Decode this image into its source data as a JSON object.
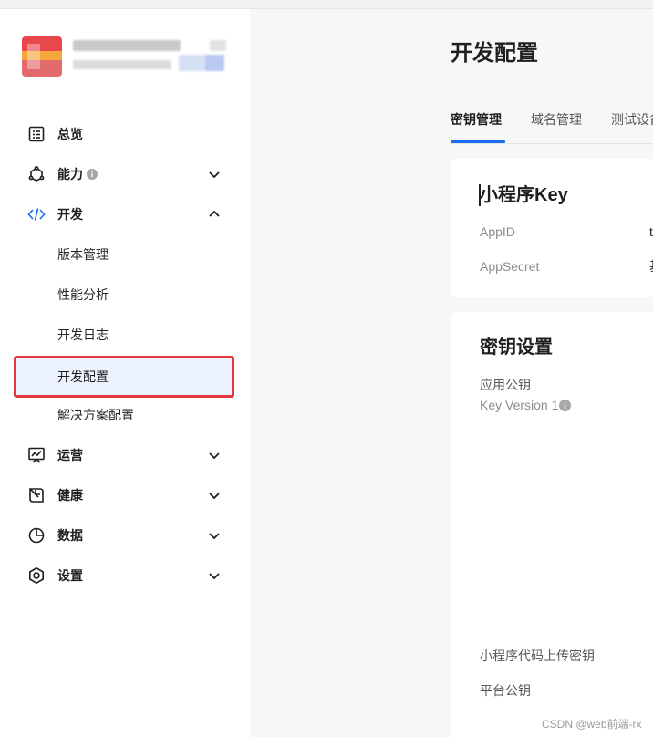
{
  "sidebar": {
    "nav": [
      {
        "id": "overview",
        "label": "总览",
        "icon": "dashboard-icon"
      },
      {
        "id": "capability",
        "label": "能力",
        "icon": "capability-icon",
        "has_info": true,
        "expanded": false
      },
      {
        "id": "develop",
        "label": "开发",
        "icon": "code-icon",
        "expanded": true
      },
      {
        "id": "operation",
        "label": "运营",
        "icon": "trend-chart-icon",
        "expanded": false
      },
      {
        "id": "health",
        "label": "健康",
        "icon": "leaf-icon",
        "expanded": false
      },
      {
        "id": "data",
        "label": "数据",
        "icon": "pie-chart-icon",
        "expanded": false
      },
      {
        "id": "settings",
        "label": "设置",
        "icon": "gear-icon",
        "expanded": false
      }
    ],
    "develop_children": [
      {
        "label": "版本管理"
      },
      {
        "label": "性能分析"
      },
      {
        "label": "开发日志"
      },
      {
        "label": "开发配置",
        "active": true
      },
      {
        "label": "解决方案配置"
      }
    ]
  },
  "main": {
    "title": "开发配置",
    "tabs": [
      {
        "label": "密钥管理",
        "active": true
      },
      {
        "label": "域名管理"
      },
      {
        "label": "测试设备"
      }
    ],
    "key_card": {
      "title": "小程序Key",
      "rows": [
        {
          "key": "AppID",
          "value": "t"
        },
        {
          "key": "AppSecret",
          "value": "基"
        }
      ]
    },
    "secret_card": {
      "title": "密钥设置",
      "app_public_key_label": "应用公钥",
      "key_version_label": "Key Version 1",
      "upload_key_label": "小程序代码上传密钥",
      "platform_public_key_label": "平台公钥"
    }
  },
  "watermark": "CSDN @web前端-rx",
  "colors": {
    "accent": "#1a6cf0",
    "highlight_border": "#e5353f",
    "active_bg": "#edf3fe"
  }
}
